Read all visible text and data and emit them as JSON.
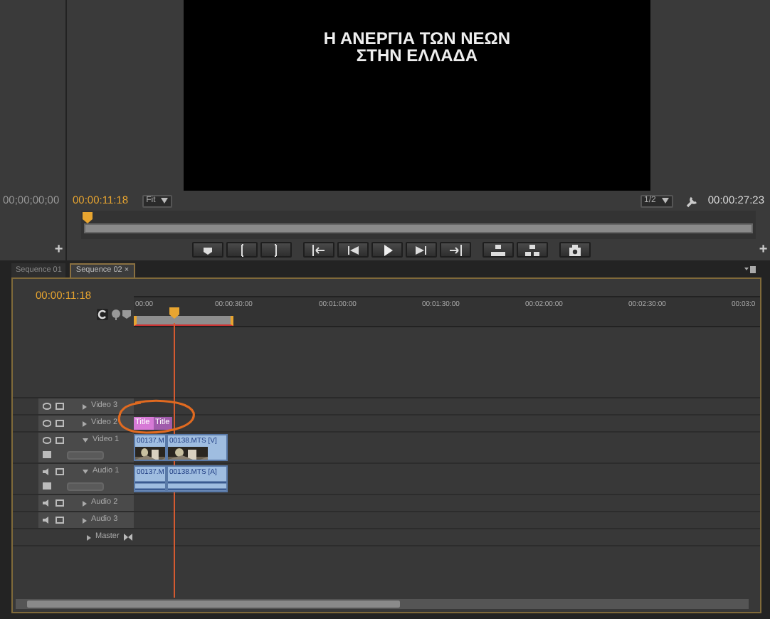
{
  "source_monitor": {
    "timecode": "00;00;00;00",
    "add_button": "+"
  },
  "program_monitor": {
    "title_lines": [
      "Η ΑΝΕΡΓΙΑ ΤΩΝ ΝΕΩΝ",
      "ΣΤΗΝ ΕΛΛΑΔΑ"
    ],
    "timecode": "00:00:11:18",
    "zoom": "Fit",
    "resolution": "1/2",
    "duration": "00:00:27:23",
    "add_button": "+",
    "transport": [
      {
        "kind": "marker"
      },
      {
        "kind": "in"
      },
      {
        "kind": "out"
      },
      {
        "kind": "go-in"
      },
      {
        "kind": "step-back"
      },
      {
        "kind": "play"
      },
      {
        "kind": "step-forward"
      },
      {
        "kind": "go-out"
      },
      {
        "kind": "lift"
      },
      {
        "kind": "extract"
      },
      {
        "kind": "camera"
      }
    ]
  },
  "timeline": {
    "tabs": [
      {
        "label": "Sequence 01",
        "selected": false
      },
      {
        "label": "Sequence 02",
        "selected": true,
        "close": "×"
      }
    ],
    "timecode": "00:00:11:18",
    "ruler": [
      "00:00",
      "00:00:30:00",
      "00:01:00:00",
      "00:01:30:00",
      "00:02:00:00",
      "00:02:30:00",
      "00:03:0"
    ],
    "tracks": [
      {
        "name": "Video 3",
        "kind": "video",
        "expanded": false
      },
      {
        "name": "Video 2",
        "kind": "video",
        "expanded": false,
        "clips": [
          {
            "label": "Title",
            "kind": "title",
            "color": "#d77ad6"
          },
          {
            "label": "Title",
            "kind": "title",
            "color": "#a05cab"
          }
        ]
      },
      {
        "name": "Video 1",
        "kind": "video",
        "expanded": true,
        "clips": [
          {
            "label": "00137.M",
            "kind": "video"
          },
          {
            "label": "00138.MTS [V]",
            "kind": "video"
          }
        ]
      },
      {
        "name": "Audio 1",
        "kind": "audio",
        "expanded": true,
        "clips": [
          {
            "label": "00137.M",
            "kind": "audio"
          },
          {
            "label": "00138.MTS [A]",
            "kind": "audio"
          }
        ]
      },
      {
        "name": "Audio 2",
        "kind": "audio",
        "expanded": false
      },
      {
        "name": "Audio 3",
        "kind": "audio",
        "expanded": false
      },
      {
        "name": "Master",
        "kind": "master",
        "expanded": false
      }
    ]
  }
}
